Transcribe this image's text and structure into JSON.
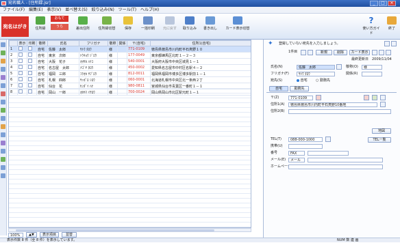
{
  "window": {
    "title": "宛名職人 - [住所録.jsr]",
    "minimize": "_",
    "maximize": "□",
    "close": "✕"
  },
  "menu": [
    "ファイル(F)",
    "編集(E)",
    "表示(V)",
    "並べ替え(S)",
    "絞り込み(N)",
    "ツール(T)",
    "ヘルプ(H)"
  ],
  "toolbar": {
    "logo": "宛名はがき",
    "buttons": [
      "住所録",
      "おもて",
      "うら",
      "差出住所",
      "住所録切替",
      "保存",
      "一括印刷",
      "元に戻す",
      "取り込み",
      "書き出し",
      "カード表示切替"
    ],
    "right": [
      "使い方ガイド",
      "終了"
    ]
  },
  "grid": {
    "headers": [
      "",
      "表示",
      "印刷",
      "敬称",
      "氏名",
      "フリガナ",
      "敬称",
      "関係",
      "〒(自宅)",
      "住所1(自宅)"
    ],
    "rows": [
      {
        "no": "1",
        "kind": "自宅",
        "name": "佐藤　太郎",
        "kana": "ｻﾄｳ ﾀﾛｳ",
        "hon": "様",
        "zip": "771-0109",
        "addr": "徳島県徳島市川内町平石夷野１０"
      },
      {
        "no": "2",
        "kind": "自宅",
        "name": "東京　次郎",
        "kana": "ﾄｳｷｮｳ ｼﾞﾛｳ",
        "hon": "様",
        "zip": "177-0049",
        "addr": "東京都練馬区北町１－２－３"
      },
      {
        "no": "3",
        "kind": "自宅",
        "name": "大阪　花子",
        "kana": "ｵｵｻｶ ﾊﾅｺ",
        "hon": "様",
        "zip": "540-0001",
        "addr": "大阪府大阪市中央区城見１－１"
      },
      {
        "no": "4",
        "kind": "自宅",
        "name": "名古屋　太郎",
        "kana": "ﾅｺﾞﾔ ﾀﾛｳ",
        "hon": "様",
        "zip": "450-0002",
        "addr": "愛知県名古屋市中村区名駅４－２"
      },
      {
        "no": "5",
        "kind": "自宅",
        "name": "福岡　三郎",
        "kana": "ﾌｸｵｶ ｻﾌﾞﾛｳ",
        "hon": "様",
        "zip": "812-0011",
        "addr": "福岡県福岡市博多区博多駅前１－１"
      },
      {
        "no": "6",
        "kind": "自宅",
        "name": "札幌　四郎",
        "kana": "ｻｯﾎﾟﾛ ｼﾛｳ",
        "hon": "様",
        "zip": "060-0001",
        "addr": "北海道札幌市中央区北一条西２丁"
      },
      {
        "no": "7",
        "kind": "自宅",
        "name": "仙台　花",
        "kana": "ｾﾝﾀﾞｲ ﾊﾅ",
        "hon": "様",
        "zip": "980-0811",
        "addr": "宮城県仙台市青葉区一番町１－１"
      },
      {
        "no": "8",
        "kind": "自宅",
        "name": "岡山　一郎",
        "kana": "ｵｶﾔﾏ ｲﾁﾛｳ",
        "hon": "様",
        "zip": "700-0024",
        "addr": "岡山県岡山市北区駅元町１－１"
      }
    ]
  },
  "bottom": {
    "zoom": "100%",
    "display": "表示項目",
    "sort": "並替"
  },
  "status": "表示件数 8 件（全 8 件）を表示しています。",
  "statusRight": [
    "NUM",
    "数",
    "連",
    "画"
  ],
  "panel": {
    "hint": "登録していない宛先を入力しましょう。",
    "record": "1件目",
    "new": "新規",
    "delete": "削除",
    "cardView": "カード表示",
    "updated_label": "最終更新日",
    "updated": "2009/11/04",
    "name_label": "氏名(N)",
    "name_value": "佐藤　太郎",
    "kana_label": "フリガナ(F)",
    "kana_value": "ｻﾄｳ ﾀﾛｳ",
    "honor_label": "敬称(O)",
    "honor_value": "様",
    "rel_label": "関係(R)",
    "addrsel_label": "宛先(S)",
    "home": "自宅",
    "work": "勤務先",
    "tab_home": "自宅",
    "tab_work": "勤務先",
    "zip_label": "〒(Z)",
    "zip_value": "771-0109",
    "addr1_label": "住所1(A)",
    "addr1_value": "徳島県徳島市川内町平石夷野10番地",
    "addr2_label": "住所2(B)",
    "addr2_value": "",
    "mapBtn": "地図",
    "tel_label": "TEL(T)",
    "tel_value": "088-000-1000",
    "telBtn": "TEL一覧",
    "mobile_label": "携帯(U)",
    "fax_label": "番号",
    "fax_type": "FAX",
    "mail_label": "メール(E)",
    "mail_type": "メール",
    "web_label": "ホームページ"
  },
  "colors": {
    "accent": "#2b6fd1",
    "toolbar": "#dbe6f6",
    "selected": "#cfe0fb",
    "zipmark": "#d9342b"
  }
}
